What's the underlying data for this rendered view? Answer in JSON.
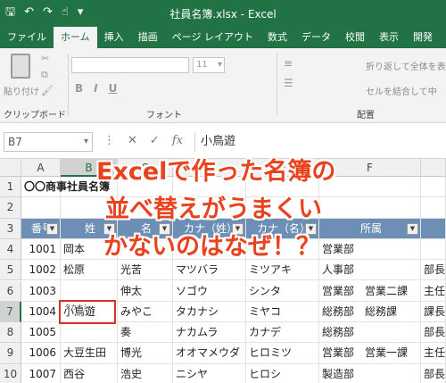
{
  "window": {
    "title": "社員名簿.xlsx  -  Excel"
  },
  "quick_access": {
    "icons": [
      "save-icon",
      "undo-icon",
      "redo-icon",
      "touch-mode-icon",
      "customize-icon"
    ]
  },
  "ribbon_tabs": [
    {
      "label": "ファイル"
    },
    {
      "label": "ホーム",
      "active": true
    },
    {
      "label": "挿入"
    },
    {
      "label": "描画"
    },
    {
      "label": "ページ レイアウト"
    },
    {
      "label": "数式"
    },
    {
      "label": "データ"
    },
    {
      "label": "校閲"
    },
    {
      "label": "表示"
    },
    {
      "label": "開発"
    }
  ],
  "ribbon": {
    "paste_label": "貼り付け",
    "clipboard_group": "クリップボード",
    "font_group": "フォント",
    "font_size": "11",
    "alignment_group": "配置",
    "wrap_text": "折り返して全体を表",
    "merge_center": "セルを結合して中"
  },
  "formula_bar": {
    "name_box": "B7",
    "formula": "小鳥遊"
  },
  "columns": [
    "A",
    "B",
    "C",
    "D",
    "E",
    "F"
  ],
  "rows": [
    "1",
    "2",
    "3",
    "4",
    "5",
    "6",
    "7",
    "8",
    "9",
    "10"
  ],
  "sheet": {
    "title": "〇〇商事社員名簿",
    "header": {
      "num": "番号",
      "last": "姓",
      "first": "名",
      "last_kana": "カナ（姓）",
      "first_kana": "カナ（名）",
      "dept": "所属"
    },
    "data": [
      {
        "num": "1001",
        "last": "岡本",
        "first": "",
        "lk": "",
        "fk": "",
        "dept": "営業部",
        "extra": ""
      },
      {
        "num": "1002",
        "last": "松原",
        "first": "光苦",
        "lk": "マツバラ",
        "fk": "ミツアキ",
        "dept": "人事部",
        "extra": "部長"
      },
      {
        "num": "1003",
        "last": "",
        "first": "伸太",
        "lk": "ソゴウ",
        "fk": "シンタ",
        "dept": "営業部　営業二課",
        "extra": "主任"
      },
      {
        "num": "1004",
        "last": "小鳥遊",
        "first": "みやこ",
        "lk": "タカナシ",
        "fk": "ミヤコ",
        "dept": "総務部　総務課",
        "extra": "課長"
      },
      {
        "num": "1005",
        "last": "",
        "first": "奏",
        "lk": "ナカムラ",
        "fk": "カナデ",
        "dept": "総務部",
        "extra": "部長"
      },
      {
        "num": "1006",
        "last": "大豆生田",
        "first": "博光",
        "lk": "オオマメウダ",
        "fk": "ヒロミツ",
        "dept": "営業部　営業一課",
        "extra": "主任"
      },
      {
        "num": "1007",
        "last": "西谷",
        "first": "浩史",
        "lk": "ニシヤ",
        "fk": "ヒロシ",
        "dept": "製造部",
        "extra": "部長"
      }
    ],
    "ruby": "タカナシ"
  },
  "headline": {
    "line1": "Excelで作った名簿の",
    "line2": "並べ替えがうまくい",
    "line3": "かないのはなぜ！？"
  },
  "colors": {
    "excel_green": "#217346",
    "header_fill": "#6d8fb5",
    "headline": "#e8421e",
    "highlight_box": "#d9322b"
  }
}
